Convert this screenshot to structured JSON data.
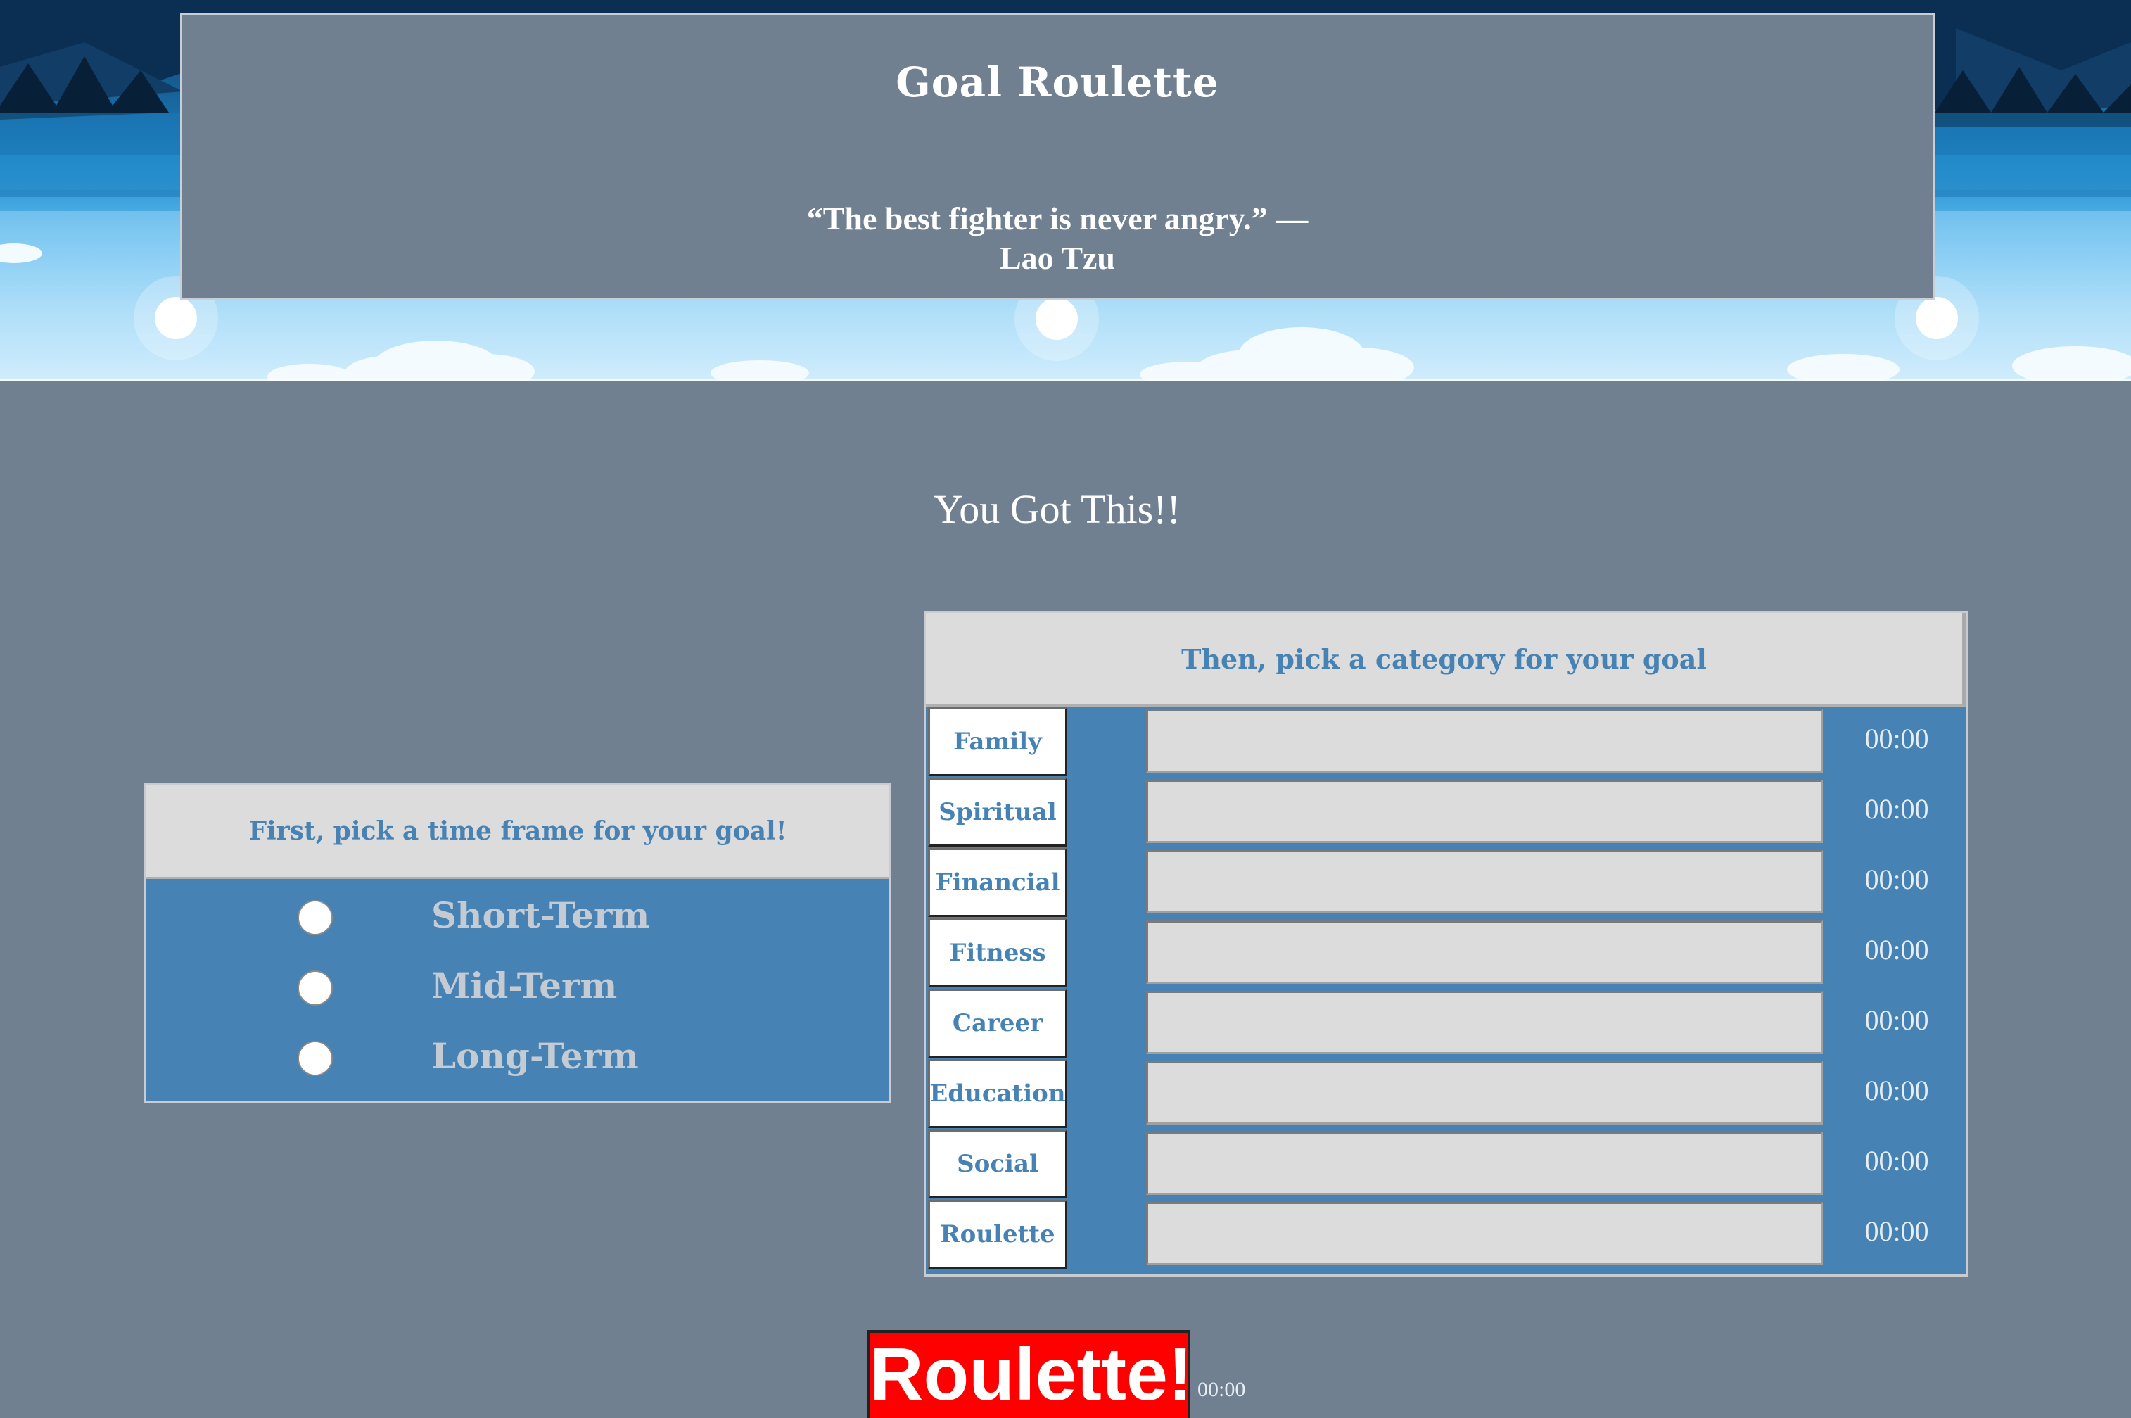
{
  "header": {
    "title": "Goal Roulette",
    "quote_line1": "“The best fighter is never angry.” —",
    "quote_line2": "Lao Tzu"
  },
  "motto": "You Got This!!",
  "timeframe": {
    "heading": "First, pick a time frame for your goal!",
    "options": [
      {
        "label": "Short-Term",
        "selected": false
      },
      {
        "label": "Mid-Term",
        "selected": false
      },
      {
        "label": "Long-Term",
        "selected": false
      }
    ]
  },
  "category": {
    "heading": "Then, pick a category for your goal",
    "rows": [
      {
        "label": "Family",
        "value": "",
        "time": "00:00"
      },
      {
        "label": "Spiritual",
        "value": "",
        "time": "00:00"
      },
      {
        "label": "Financial",
        "value": "",
        "time": "00:00"
      },
      {
        "label": "Fitness",
        "value": "",
        "time": "00:00"
      },
      {
        "label": "Career",
        "value": "",
        "time": "00:00"
      },
      {
        "label": "Education",
        "value": "",
        "time": "00:00"
      },
      {
        "label": "Social",
        "value": "",
        "time": "00:00"
      },
      {
        "label": "Roulette",
        "value": "",
        "time": "00:00"
      }
    ]
  },
  "roulette": {
    "button_label": "Roulette!",
    "time": "00:00"
  },
  "colors": {
    "page_background": "#708090",
    "panel_blue": "#4682b4",
    "panel_header": "#dcdcdc",
    "roulette_red": "#ff0000"
  }
}
